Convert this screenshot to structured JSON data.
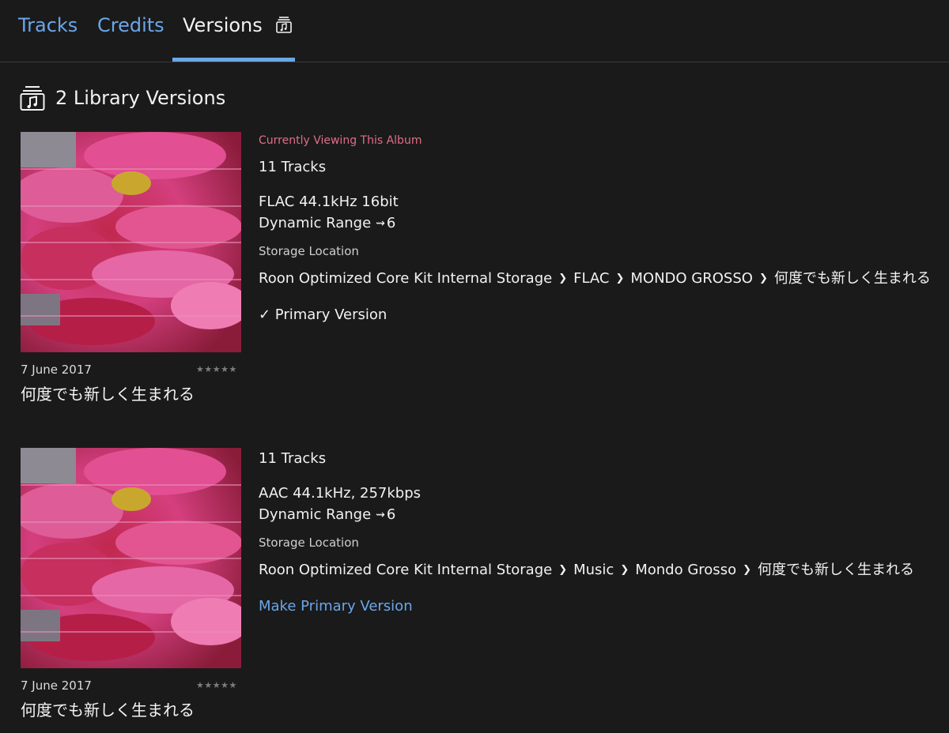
{
  "tabs": [
    {
      "label": "Tracks"
    },
    {
      "label": "Credits"
    },
    {
      "label": "Versions"
    }
  ],
  "section": {
    "title": "2 Library Versions"
  },
  "versions": [
    {
      "current_label": "Currently Viewing This Album",
      "tracks": "11 Tracks",
      "format": "FLAC 44.1kHz 16bit",
      "dynamic_range_label": "Dynamic Range",
      "dynamic_range_value": "6",
      "storage_label": "Storage Location",
      "path": [
        "Roon Optimized Core Kit Internal Storage",
        "FLAC",
        "MONDO GROSSO",
        "何度でも新しく生まれる"
      ],
      "primary_label": "✓ Primary Version",
      "date": "7 June 2017",
      "stars": "★★★★★",
      "album_title": "何度でも新しく生まれる"
    },
    {
      "tracks": "11 Tracks",
      "format": "AAC 44.1kHz, 257kbps",
      "dynamic_range_label": "Dynamic Range",
      "dynamic_range_value": "6",
      "storage_label": "Storage Location",
      "path": [
        "Roon Optimized Core Kit Internal Storage",
        "Music",
        "Mondo Grosso",
        "何度でも新しく生まれる"
      ],
      "primary_label": "Make Primary Version",
      "date": "7 June 2017",
      "stars": "★★★★★",
      "album_title": "何度でも新しく生まれる"
    }
  ],
  "colors": {
    "background": "#1a1a1b",
    "accent_blue": "#6aa7e8",
    "current_pink": "#e06d86"
  },
  "icons": {
    "versions_tab": "album-stack-icon",
    "section": "album-stack-icon",
    "dynamic_range": "dynamic-range-icon",
    "path_separator": "chevron-right-icon"
  }
}
